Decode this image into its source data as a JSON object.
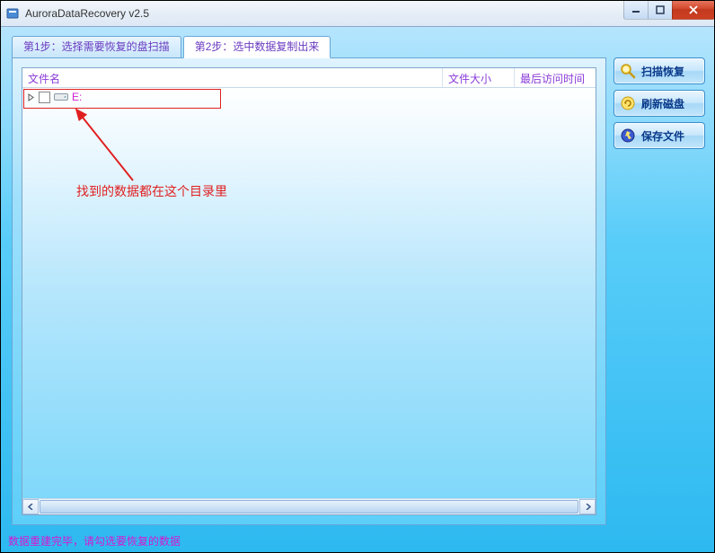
{
  "window": {
    "title": "AuroraDataRecovery v2.5"
  },
  "tabs": [
    {
      "label": "第1步：选择需要恢复的盘扫描",
      "active": false
    },
    {
      "label": "第2步：选中数据复制出来",
      "active": true
    }
  ],
  "columns": {
    "name": "文件名",
    "size": "文件大小",
    "time": "最后访问时间"
  },
  "tree": {
    "root": {
      "label": "E:"
    }
  },
  "annotation": {
    "text": "找到的数据都在这个目录里"
  },
  "sidebar": {
    "scan": "扫描恢复",
    "refresh": "刷新磁盘",
    "save": "保存文件"
  },
  "status": {
    "text": "数据重建完毕，请勾选要恢复的数据"
  }
}
